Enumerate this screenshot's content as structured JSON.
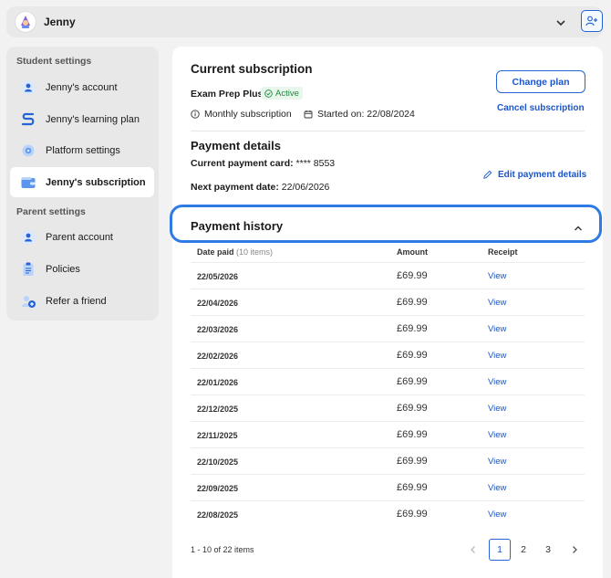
{
  "topbar": {
    "user_name": "Jenny"
  },
  "sidebar": {
    "student_title": "Student settings",
    "parent_title": "Parent settings",
    "items": [
      {
        "label": "Jenny's account",
        "icon": "person-icon"
      },
      {
        "label": "Jenny's learning plan",
        "icon": "path-icon"
      },
      {
        "label": "Platform settings",
        "icon": "gear-icon"
      },
      {
        "label": "Jenny's subscription",
        "icon": "wallet-icon",
        "active": true
      },
      {
        "label": "Parent account",
        "icon": "person-icon"
      },
      {
        "label": "Policies",
        "icon": "clipboard-icon"
      },
      {
        "label": "Refer a friend",
        "icon": "refer-icon"
      }
    ]
  },
  "subscription": {
    "title": "Current subscription",
    "plan": "Exam Prep Plus",
    "status": "Active",
    "frequency": "Monthly subscription",
    "started": "Started on: 22/08/2024",
    "change_plan": "Change plan",
    "cancel": "Cancel subscription"
  },
  "payment": {
    "title": "Payment details",
    "card_label": "Current payment card:",
    "card_value": "**** 8553",
    "next_label": "Next payment date:",
    "next_value": "22/06/2026",
    "edit": "Edit payment details"
  },
  "history": {
    "title": "Payment history",
    "col_date": "Date paid",
    "count": "(10 items)",
    "col_amount": "Amount",
    "col_receipt": "Receipt",
    "rows": [
      {
        "date": "22/05/2026",
        "amount": "£69.99",
        "receipt": "View"
      },
      {
        "date": "22/04/2026",
        "amount": "£69.99",
        "receipt": "View"
      },
      {
        "date": "22/03/2026",
        "amount": "£69.99",
        "receipt": "View"
      },
      {
        "date": "22/02/2026",
        "amount": "£69.99",
        "receipt": "View"
      },
      {
        "date": "22/01/2026",
        "amount": "£69.99",
        "receipt": "View"
      },
      {
        "date": "22/12/2025",
        "amount": "£69.99",
        "receipt": "View"
      },
      {
        "date": "22/11/2025",
        "amount": "£69.99",
        "receipt": "View"
      },
      {
        "date": "22/10/2025",
        "amount": "£69.99",
        "receipt": "View"
      },
      {
        "date": "22/09/2025",
        "amount": "£69.99",
        "receipt": "View"
      },
      {
        "date": "22/08/2025",
        "amount": "£69.99",
        "receipt": "View"
      }
    ],
    "range": "1 - 10 of 22 items",
    "pages": [
      "1",
      "2",
      "3"
    ]
  },
  "colors": {
    "accent": "#2563d6",
    "active_green": "#1e8a3d",
    "highlight": "#2f7be5"
  }
}
